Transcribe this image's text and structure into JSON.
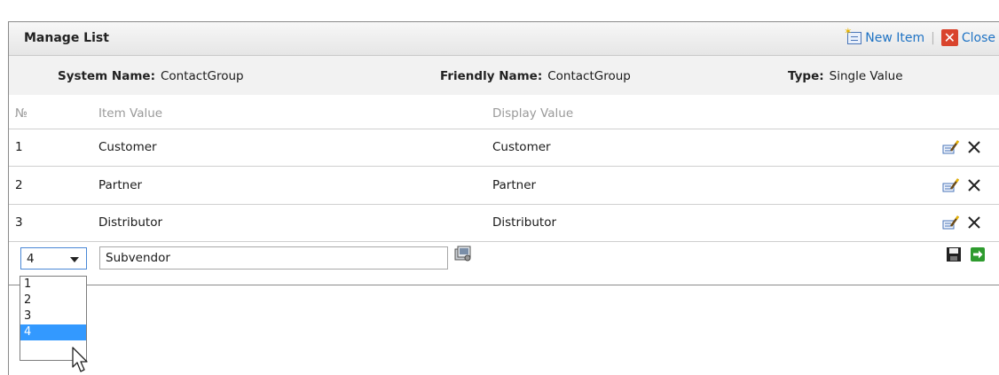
{
  "header": {
    "title": "Manage List",
    "new_item_label": "New Item",
    "separator": "|",
    "close_label": "Close",
    "close_glyph": "✕"
  },
  "info": {
    "system_name_label": "System Name:",
    "system_name_value": "ContactGroup",
    "friendly_name_label": "Friendly Name:",
    "friendly_name_value": "ContactGroup",
    "type_label": "Type:",
    "type_value": "Single Value"
  },
  "columns": {
    "number": "№",
    "item_value": "Item Value",
    "display_value": "Display Value"
  },
  "rows": [
    {
      "number": "1",
      "item_value": "Customer",
      "display_value": "Customer"
    },
    {
      "number": "2",
      "item_value": "Partner",
      "display_value": "Partner"
    },
    {
      "number": "3",
      "item_value": "Distributor",
      "display_value": "Distributor"
    }
  ],
  "edit_row": {
    "order_value": "4",
    "item_value": "Subvendor"
  },
  "dropdown": {
    "options": [
      "1",
      "2",
      "3",
      "4"
    ],
    "selected": "4"
  },
  "colors": {
    "link": "#1f73c4",
    "close": "#d9442d",
    "selected_option": "#3399ff",
    "next": "#2e9b2e"
  },
  "icons": [
    "new-item-icon",
    "close-icon",
    "edit-icon",
    "delete-icon",
    "lookup-icon",
    "save-icon",
    "next-arrow-icon",
    "mouse-cursor-icon"
  ]
}
